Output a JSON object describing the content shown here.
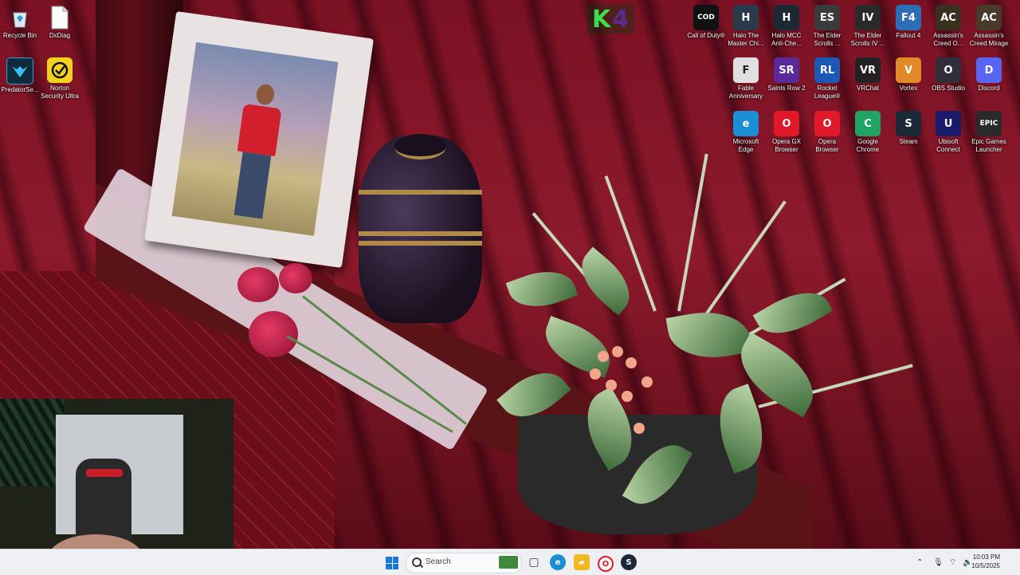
{
  "desktop": {
    "left_icons": [
      {
        "label": "Recycle Bin",
        "icon": "recycle-bin-icon"
      },
      {
        "label": "DxDiag",
        "icon": "document-icon"
      },
      {
        "label": "PredatorSe...",
        "icon": "predator-sense-icon"
      },
      {
        "label": "Norton Security Ultra",
        "icon": "norton-icon"
      }
    ],
    "right_icons": [
      {
        "label": "Call of Duty®",
        "icon": "call-of-duty-icon",
        "glyph": "COD",
        "color": "#111111"
      },
      {
        "label": "Halo The Master Chi...",
        "icon": "halo-icon",
        "glyph": "H",
        "color": "#2a3a4a"
      },
      {
        "label": "Halo MCC Anti-Che...",
        "icon": "halo-mcc-icon",
        "glyph": "H",
        "color": "#1c2834"
      },
      {
        "label": "The Elder Scrolls ...",
        "icon": "elder-scrolls-icon",
        "glyph": "ES",
        "color": "#3a3a3a"
      },
      {
        "label": "The Elder Scrolls IV ...",
        "icon": "oblivion-icon",
        "glyph": "IV",
        "color": "#2a2a2a"
      },
      {
        "label": "Fallout 4",
        "icon": "fallout-icon",
        "glyph": "F4",
        "color": "#2d6db4"
      },
      {
        "label": "Assassin's Creed O...",
        "icon": "assassins-creed-odyssey-icon",
        "glyph": "AC",
        "color": "#3a3020"
      },
      {
        "label": "Assassin's Creed Mirage",
        "icon": "assassins-creed-mirage-icon",
        "glyph": "AC",
        "color": "#4a3a2a"
      },
      {
        "label": "Fable Anniversary",
        "icon": "fable-icon",
        "glyph": "F",
        "color": "#e0e0e0"
      },
      {
        "label": "Saints Row 2",
        "icon": "saints-row-icon",
        "glyph": "SR",
        "color": "#5a2a9a"
      },
      {
        "label": "Rocket League®",
        "icon": "rocket-league-icon",
        "glyph": "RL",
        "color": "#1a5ab4"
      },
      {
        "label": "VRChat",
        "icon": "vrchat-icon",
        "glyph": "VR",
        "color": "#222222"
      },
      {
        "label": "Vortex",
        "icon": "vortex-icon",
        "glyph": "V",
        "color": "#e08a2a"
      },
      {
        "label": "OBS Studio",
        "icon": "obs-icon",
        "glyph": "O",
        "color": "#302e3a"
      },
      {
        "label": "Discord",
        "icon": "discord-icon",
        "glyph": "D",
        "color": "#5865f2"
      },
      {
        "label": "Microsoft Edge",
        "icon": "edge-icon",
        "glyph": "e",
        "color": "#1b8fd6"
      },
      {
        "label": "Opera GX Browser",
        "icon": "opera-gx-icon",
        "glyph": "O",
        "color": "#e0182a"
      },
      {
        "label": "Opera Browser",
        "icon": "opera-icon",
        "glyph": "O",
        "color": "#e0182a"
      },
      {
        "label": "Google Chrome",
        "icon": "chrome-icon",
        "glyph": "C",
        "color": "#1fa463"
      },
      {
        "label": "Steam",
        "icon": "steam-icon",
        "glyph": "S",
        "color": "#1b2838"
      },
      {
        "label": "Ubisoft Connect",
        "icon": "ubisoft-icon",
        "glyph": "U",
        "color": "#1a1a6a"
      },
      {
        "label": "Epic Games Launcher",
        "icon": "epic-games-icon",
        "glyph": "EPIC",
        "color": "#2a2a2a"
      }
    ],
    "overlay_logo": {
      "left": "K",
      "right": "4"
    }
  },
  "taskbar": {
    "search_placeholder": "Search",
    "pinned": [
      {
        "name": "task-view",
        "glyph": "▢",
        "color": "#333333"
      },
      {
        "name": "edge",
        "glyph": "e",
        "color": "#1b8fd6"
      },
      {
        "name": "file-explorer",
        "glyph": "▰",
        "color": "#f2b822"
      },
      {
        "name": "opera-gx",
        "glyph": "O",
        "color": "#e0182a"
      },
      {
        "name": "steam",
        "glyph": "S",
        "color": "#1b2838"
      }
    ],
    "clock_time": "10:03 PM",
    "clock_date": "10/5/2025"
  }
}
